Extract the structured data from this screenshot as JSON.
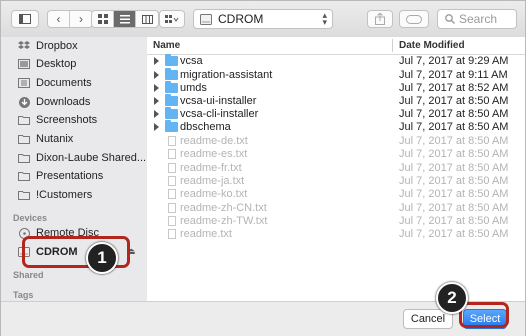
{
  "toolbar": {
    "location": "CDROM",
    "search_placeholder": "Search",
    "view_mode_selected": "list"
  },
  "sidebar": {
    "favorites": [
      {
        "label": "Dropbox",
        "icon": "dropbox-icon"
      },
      {
        "label": "Desktop",
        "icon": "desktop-icon"
      },
      {
        "label": "Documents",
        "icon": "documents-icon"
      },
      {
        "label": "Downloads",
        "icon": "downloads-icon"
      },
      {
        "label": "Screenshots",
        "icon": "folder-icon"
      },
      {
        "label": "Nutanix",
        "icon": "folder-icon"
      },
      {
        "label": "Dixon-Laube Shared...",
        "icon": "folder-icon"
      },
      {
        "label": "Presentations",
        "icon": "folder-icon"
      },
      {
        "label": "!Customers",
        "icon": "folder-icon"
      }
    ],
    "devices_header": "Devices",
    "devices": [
      {
        "label": "Remote Disc",
        "icon": "disc-icon"
      },
      {
        "label": "CDROM",
        "icon": "drive-icon"
      }
    ],
    "shared_header": "Shared",
    "tags_header": "Tags"
  },
  "list": {
    "col_name": "Name",
    "col_date": "Date Modified",
    "rows": [
      {
        "name": "vcsa",
        "date": "Jul 7, 2017 at 9:29 AM",
        "kind": "folder"
      },
      {
        "name": "migration-assistant",
        "date": "Jul 7, 2017 at 9:11 AM",
        "kind": "folder"
      },
      {
        "name": "umds",
        "date": "Jul 7, 2017 at 8:52 AM",
        "kind": "folder"
      },
      {
        "name": "vcsa-ui-installer",
        "date": "Jul 7, 2017 at 8:50 AM",
        "kind": "folder"
      },
      {
        "name": "vcsa-cli-installer",
        "date": "Jul 7, 2017 at 8:50 AM",
        "kind": "folder"
      },
      {
        "name": "dbschema",
        "date": "Jul 7, 2017 at 8:50 AM",
        "kind": "folder"
      },
      {
        "name": "readme-de.txt",
        "date": "Jul 7, 2017 at 8:50 AM",
        "kind": "file"
      },
      {
        "name": "readme-es.txt",
        "date": "Jul 7, 2017 at 8:50 AM",
        "kind": "file"
      },
      {
        "name": "readme-fr.txt",
        "date": "Jul 7, 2017 at 8:50 AM",
        "kind": "file"
      },
      {
        "name": "readme-ja.txt",
        "date": "Jul 7, 2017 at 8:50 AM",
        "kind": "file"
      },
      {
        "name": "readme-ko.txt",
        "date": "Jul 7, 2017 at 8:50 AM",
        "kind": "file"
      },
      {
        "name": "readme-zh-CN.txt",
        "date": "Jul 7, 2017 at 8:50 AM",
        "kind": "file"
      },
      {
        "name": "readme-zh-TW.txt",
        "date": "Jul 7, 2017 at 8:50 AM",
        "kind": "file"
      },
      {
        "name": "readme.txt",
        "date": "Jul 7, 2017 at 8:50 AM",
        "kind": "file"
      }
    ]
  },
  "footer": {
    "cancel_label": "Cancel",
    "select_label": "Select"
  },
  "callouts": {
    "step1": "1",
    "step2": "2"
  },
  "colors": {
    "accent": "#1f78f3",
    "folder": "#62b5f2",
    "callout_red": "#b3261e"
  }
}
